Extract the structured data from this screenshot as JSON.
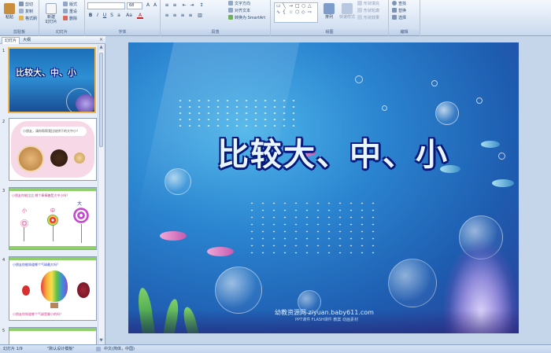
{
  "ribbon": {
    "clipboard": {
      "paste": "粘贴",
      "cut": "剪切",
      "copy": "复制",
      "format_painter": "格式刷",
      "label": "剪贴板"
    },
    "slides": {
      "new_slide": "新建\n幻灯片",
      "layout": "版式",
      "reset": "重设",
      "delete": "删除",
      "label": "幻灯片"
    },
    "font": {
      "font_size": "68",
      "label": "字体"
    },
    "paragraph": {
      "text_direction": "文字方向",
      "align_text": "对齐文本",
      "convert_smartart": "转换为 SmartArt",
      "label": "段落"
    },
    "drawing": {
      "arrange": "排列",
      "quick_styles": "快速样式",
      "shape_fill": "形状填充",
      "shape_outline": "形状轮廓",
      "shape_effects": "形状效果",
      "label": "绘图"
    },
    "editing": {
      "find": "查找",
      "replace": "替换",
      "select": "选择",
      "label": "编辑"
    }
  },
  "panel": {
    "tabs": [
      "幻灯片",
      "大纲"
    ],
    "close": "×",
    "thumbnails": [
      {
        "number": "1",
        "title": "比较大、中、小"
      },
      {
        "number": "2",
        "caption": "小朋友，请你帮帮我比较饼干的大中小？"
      },
      {
        "number": "3",
        "caption": "小朋友你能比比 哪个棒棒糖是大中小吗？",
        "labels": [
          "小",
          "中",
          "大"
        ]
      },
      {
        "number": "4",
        "caption": "小朋友你能知道哪个气球最大吗？",
        "footer": "小朋友你知道哪个气球是最小的吗？"
      },
      {
        "number": "5"
      }
    ]
  },
  "slide": {
    "title": "比较大、中、小",
    "watermark": "幼教资源网 ziyuan.baby611.com",
    "watermark_sub": "PPT课件 FLASH课件 教案 动画素材"
  },
  "status": {
    "slide_count": "幻灯片 1/9",
    "theme": "\"默认设计模板\"",
    "language": "中文(简体，中国)"
  },
  "colors": {
    "ribbon_bg": "#dbe6f4",
    "selection": "#f2b54a",
    "title_fill": "#e8f6ff",
    "title_outline": "#06167a"
  }
}
